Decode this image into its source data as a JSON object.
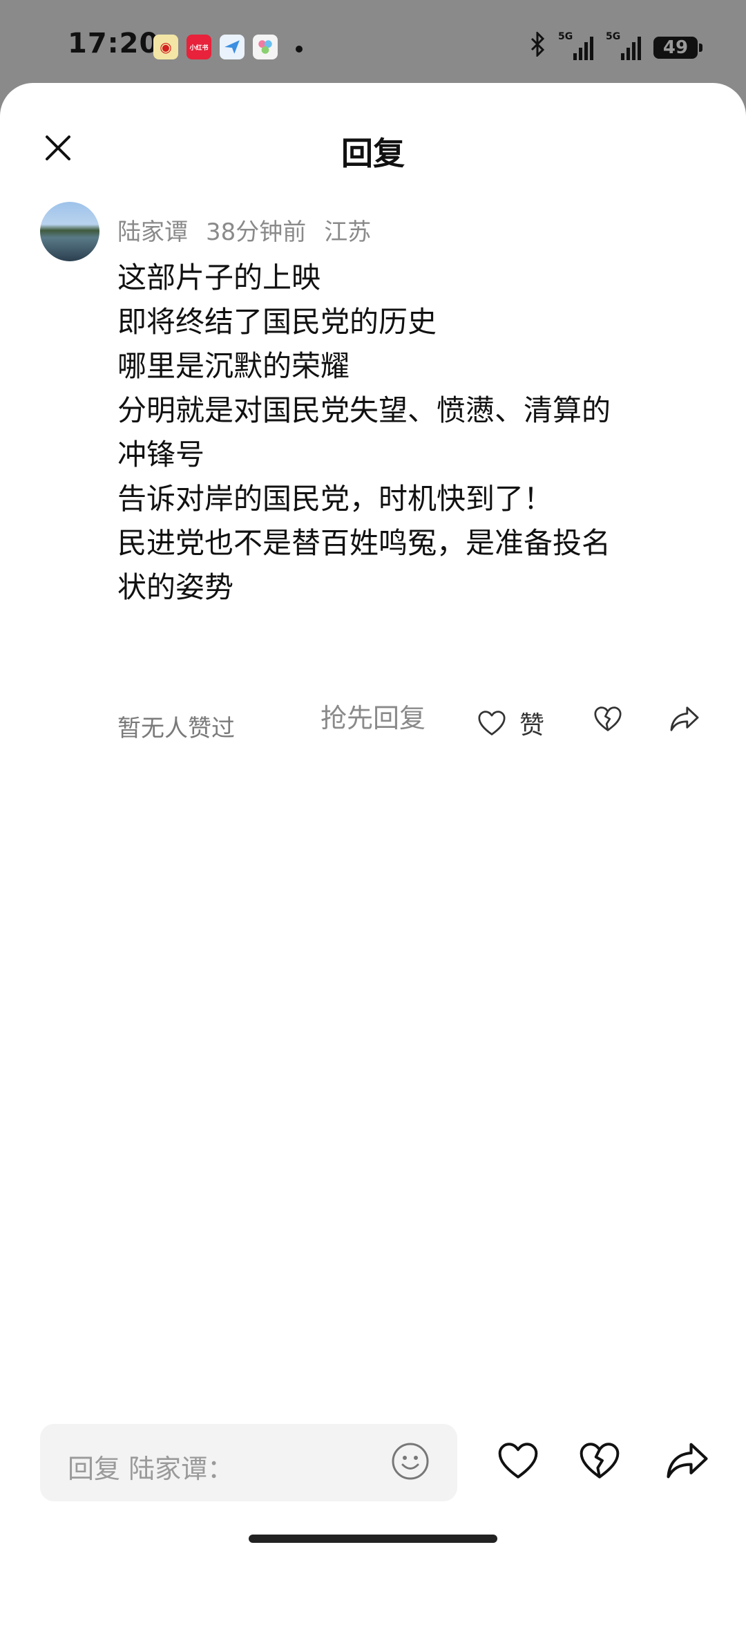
{
  "status_bar": {
    "time": "17:20",
    "apps": [
      "weibo-icon",
      "xiaohongshu-icon",
      "message-icon",
      "app-icon"
    ],
    "signal_1_tag": "5G",
    "signal_2_tag": "5G",
    "battery": "49"
  },
  "header": {
    "title": "回复"
  },
  "comment": {
    "author": "陆家谭",
    "time": "38分钟前",
    "location": "江苏",
    "lines": [
      "这部片子的上映",
      "即将终结了国民党的历史",
      "哪里是沉默的荣耀",
      "分明就是对国民党失望、愤懑、清算的",
      "冲锋号",
      "告诉对岸的国民党，时机快到了！",
      "民进党也不是替百姓鸣冤，是准备投名",
      "状的姿势"
    ],
    "likes_text": "暂无人赞过",
    "like_label": "赞"
  },
  "first_reply": "抢先回复",
  "bottom_bar": {
    "placeholder": "回复 陆家谭："
  },
  "colors": {
    "sheet_bg": "#ffffff",
    "status_bg": "#8a8a8a",
    "muted_text": "#8a8a8a",
    "input_bg": "#f3f3f3"
  }
}
